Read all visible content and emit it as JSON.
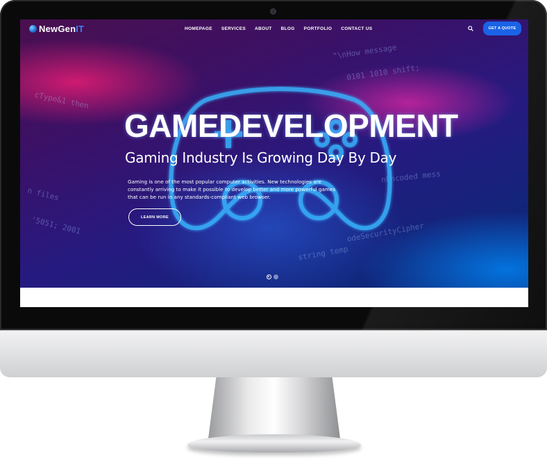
{
  "brand": {
    "name": "NewGen",
    "accent": "IT"
  },
  "nav": {
    "items": [
      "HOMEPAGE",
      "SERVICES",
      "ABOUT",
      "BLOG",
      "PORTFOLIO",
      "CONTACT US"
    ],
    "search_icon": "search-icon",
    "cta_label": "GET A QUOTE"
  },
  "hero": {
    "title": "GAMEDEVELOPMENT",
    "subtitle": "Gaming Industry Is Growing Day By Day",
    "description": "Gaming is one of the most popular computer activities. New technologies are constantly arriving to make it possible to develop better and more powerful games that can be run in any standards-compliant web browser.",
    "button_label": "LEARN MORE",
    "slides": {
      "count": 2,
      "active": 1
    }
  },
  "colors": {
    "accent": "#1a63e6",
    "brand_accent": "#2b86ff"
  }
}
